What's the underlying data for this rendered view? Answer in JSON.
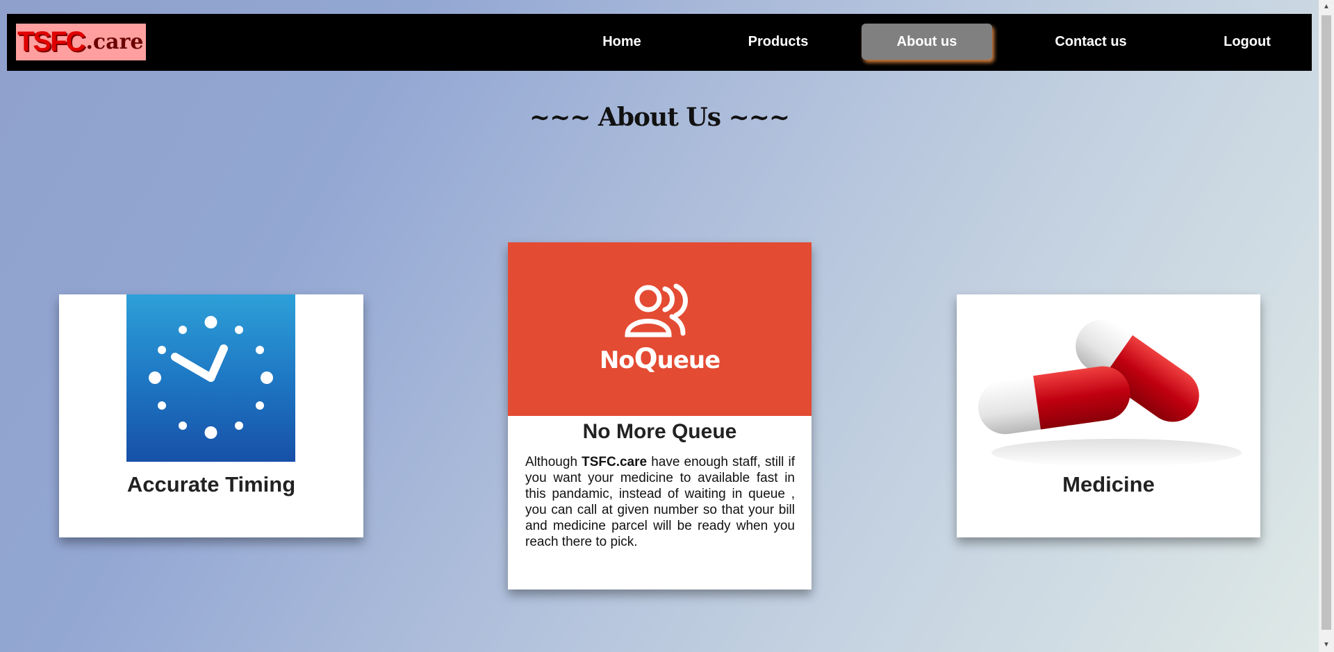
{
  "logo": {
    "brand": "TSFC",
    "tld": ".care"
  },
  "nav": {
    "items": [
      {
        "label": "Home"
      },
      {
        "label": "Products"
      },
      {
        "label": "About us"
      },
      {
        "label": "Contact us"
      },
      {
        "label": "Logout"
      }
    ],
    "active": "About us"
  },
  "heading": "~~~ About Us ~~~",
  "cards": {
    "left": {
      "title": "Accurate Timing",
      "icon": "clock-icon"
    },
    "middle": {
      "logo_no": "No",
      "logo_q": "Q",
      "logo_ueue": "ueue",
      "title": "No More Queue",
      "text_before": "Although ",
      "text_bold": "TSFC.care",
      "text_after": " have enough staff, still if you want your medicine to available fast in this pandamic, instead of waiting in queue , you can call at given number so that your bill and medicine parcel will be ready when you reach there to pick.",
      "icon": "people-icon"
    },
    "right": {
      "title": "Medicine",
      "icon": "capsule-icon"
    }
  },
  "colors": {
    "navbar": "#000000",
    "active_tab": "#808080",
    "logo_bg": "#ff9f9f",
    "queue_red": "#e44b33",
    "clock_blue": "#1e78c4"
  }
}
